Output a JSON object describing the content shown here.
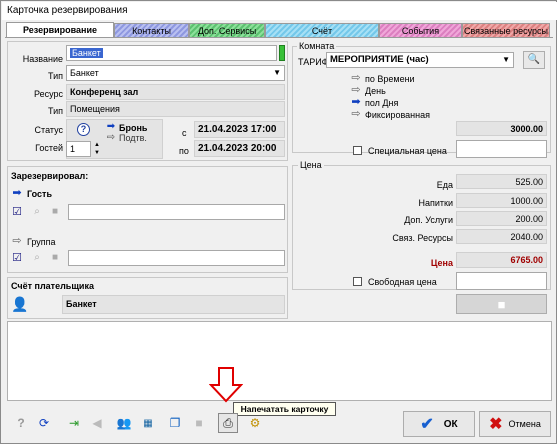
{
  "window": {
    "title": "Карточка резервирования"
  },
  "tabs": [
    {
      "label": "Резервирование"
    },
    {
      "label": "Контакты"
    },
    {
      "label": "Доп. Сервисы"
    },
    {
      "label": "Счёт"
    },
    {
      "label": "События"
    },
    {
      "label": "Связанные ресурсы"
    }
  ],
  "left": {
    "name_label": "Название",
    "name_value": "Банкет",
    "type_label": "Тип",
    "type_value": "Банкет",
    "resource_label": "Ресурс",
    "resource_value": "Конференц зал",
    "rtype_label": "Тип",
    "rtype_value": "Помещения",
    "status_label": "Статус",
    "status_value": "Бронь",
    "status_sub": "Подтв.",
    "guests_label": "Гостей",
    "guests_value": "1",
    "from_label": "с",
    "from_value": "21.04.2023 17:00",
    "to_label": "по",
    "to_value": "21.04.2023 20:00"
  },
  "reserved": {
    "title": "Зарезервировал:",
    "guest_label": "Гость",
    "group_label": "Группа"
  },
  "payer": {
    "title": "Счёт плательщика",
    "value": "Банкет"
  },
  "room": {
    "group_title": "Комната",
    "tariff_label": "ТАРИФ",
    "tariff_value": "МЕРОПРИЯТИЕ (час)",
    "options": [
      "по Времени",
      "День",
      "пол Дня",
      "Фиксированная"
    ],
    "selected_option": "пол Дня",
    "total": "3000.00",
    "special_price_label": "Специальная цена"
  },
  "price": {
    "group_title": "Цена",
    "rows": [
      {
        "label": "Еда",
        "value": "525.00"
      },
      {
        "label": "Напитки",
        "value": "1000.00"
      },
      {
        "label": "Доп. Услуги",
        "value": "200.00"
      },
      {
        "label": "Связ. Ресурсы",
        "value": "2040.00"
      }
    ],
    "total_label": "Цена",
    "total_value": "6765.00",
    "free_price_label": "Свободная цена"
  },
  "toolbar": {
    "tooltip": "Напечатать карточку",
    "ok_label": "ОК",
    "cancel_label": "Отмена"
  },
  "colors": {
    "accent_red": "#a00000",
    "arrow_red": "#e00000",
    "link_blue": "#1040c0",
    "ok_blue": "#1860d0"
  }
}
